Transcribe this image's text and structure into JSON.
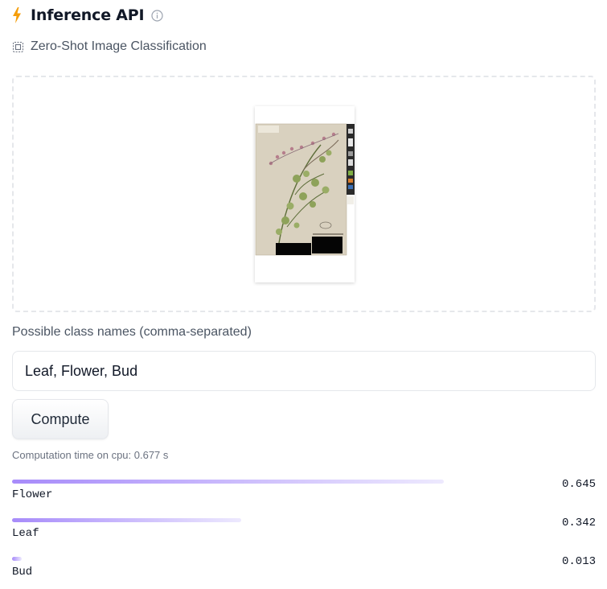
{
  "header": {
    "title": "Inference API",
    "bolt_icon": "lightning-bolt-icon",
    "info_icon": "info-icon",
    "bolt_color": "#f59e0b"
  },
  "task": {
    "icon": "image-classification-icon",
    "label": "Zero-Shot Image Classification"
  },
  "dropzone": {
    "image": "pressed-plant-herbarium-specimen"
  },
  "class_input": {
    "label": "Possible class names (comma-separated)",
    "value": "Leaf, Flower, Bud"
  },
  "compute_button": {
    "label": "Compute"
  },
  "timing": {
    "text": "Computation time on cpu: 0.677 s"
  },
  "results": [
    {
      "label": "Flower",
      "score": "0.645",
      "value": 0.645
    },
    {
      "label": "Leaf",
      "score": "0.342",
      "value": 0.342
    },
    {
      "label": "Bud",
      "score": "0.013",
      "value": 0.013
    }
  ],
  "colors": {
    "bar_start": "#a78bfa",
    "bar_end": "#ede9fe",
    "border": "#e5e7eb"
  }
}
